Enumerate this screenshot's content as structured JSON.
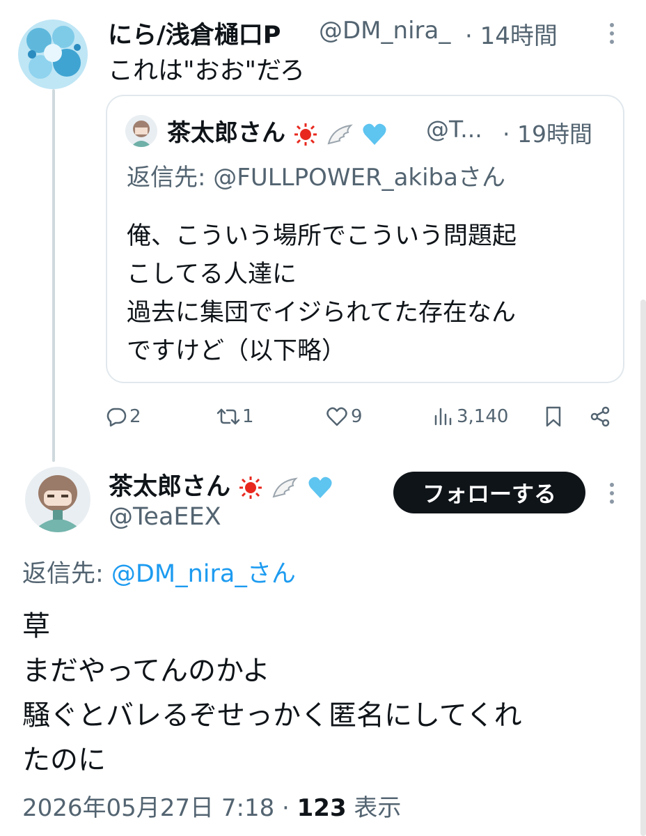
{
  "tweet1": {
    "display_name": "にら/浅倉樋口P",
    "handle": "@DM_nira_",
    "time": "· 14時間",
    "text": "これは\"おお\"だろ",
    "avatar_icon": "blue-flower-avatar"
  },
  "quote": {
    "display_name": "茶太郎さん",
    "handle": "@T...",
    "time": "· 19時間",
    "reply_to": "返信先: @FULLPOWER_akibaさん",
    "lines": [
      "俺、こういう場所でこういう問題起",
      "こしてる人達に",
      "過去に集団でイジられてた存在なん",
      "ですけど（以下略）"
    ]
  },
  "actions": {
    "replies": "2",
    "retweets": "1",
    "likes": "9",
    "views": "3,140"
  },
  "tweet2": {
    "display_name": "茶太郎さん",
    "handle": "@TeaEEX",
    "follow_label": "フォローする",
    "reply_prefix": "返信先: ",
    "reply_link": "@DM_nira_さん",
    "lines": [
      "草",
      "まだやってんのかよ",
      "騒ぐとバレるぞせっかく匿名にしてくれ",
      "たのに"
    ],
    "date": "2026年05月27日 7:18 · ",
    "view_count": "123",
    "view_label": " 表示"
  },
  "colors": {
    "text": "#0f1419",
    "secondary": "#536471",
    "link": "#1d9bf0",
    "button_bg": "#0f1419"
  }
}
